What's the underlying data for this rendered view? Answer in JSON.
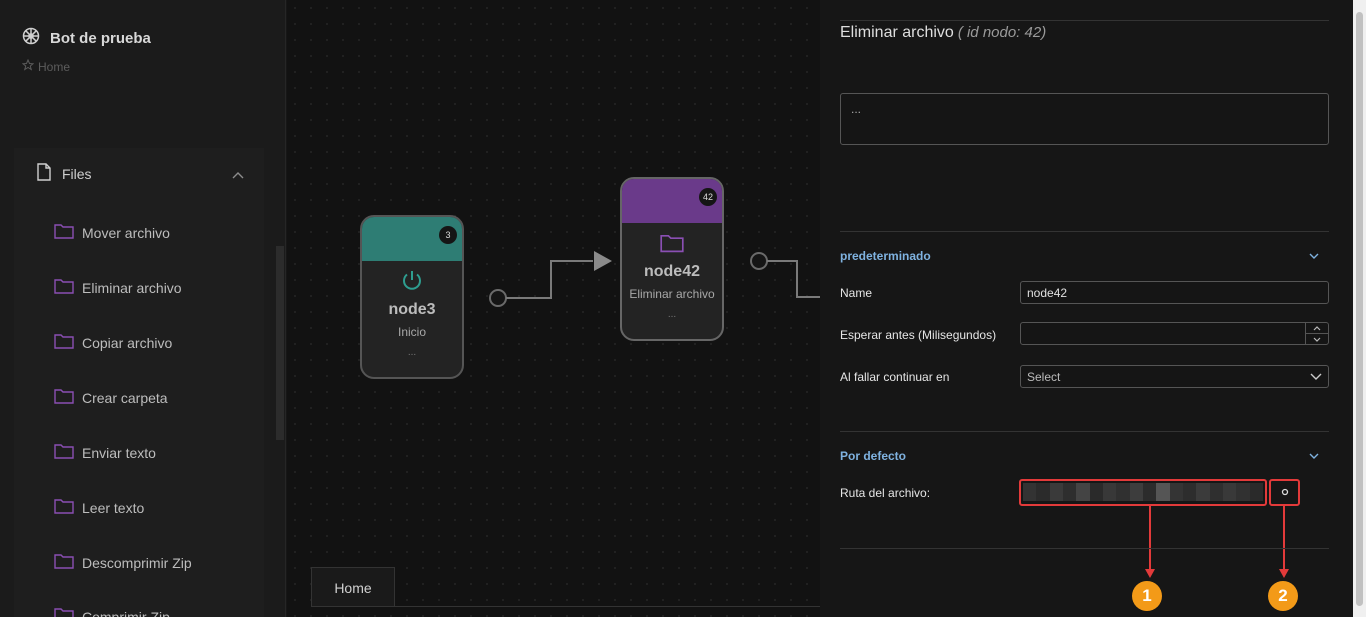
{
  "sidebar": {
    "title": "Bot de prueba",
    "breadcrumb": "Home",
    "section_label": "Files",
    "items": [
      {
        "label": "Mover archivo"
      },
      {
        "label": "Eliminar archivo"
      },
      {
        "label": "Copiar archivo"
      },
      {
        "label": "Crear carpeta"
      },
      {
        "label": "Enviar texto"
      },
      {
        "label": "Leer texto"
      },
      {
        "label": "Descomprimir Zip"
      },
      {
        "label": "Comprimir Zip"
      }
    ]
  },
  "canvas": {
    "nodes": [
      {
        "id": "3",
        "title": "node3",
        "subtitle": "Inicio",
        "dots": "...",
        "color": "#2e7d74",
        "icon": "power-icon"
      },
      {
        "id": "42",
        "title": "node42",
        "subtitle": "Eliminar archivo",
        "dots": "...",
        "color": "#6a3a8a",
        "icon": "folder-icon"
      }
    ],
    "tab_label": "Home"
  },
  "panel": {
    "title": "Eliminar archivo",
    "id_note": "( id nodo: 42)",
    "description_value": "...",
    "section1": {
      "title": "predeterminado",
      "name_label": "Name",
      "name_value": "node42",
      "wait_label": "Esperar antes (Milisegundos)",
      "wait_value": "",
      "fail_label": "Al fallar continuar en",
      "fail_value": "Select"
    },
    "section2": {
      "title": "Por defecto",
      "path_label": "Ruta del archivo:"
    },
    "callouts": [
      "1",
      "2"
    ]
  },
  "colors": {
    "accent_blue": "#7fb2e0",
    "folder_purple": "#8a4fb3",
    "annotation_red": "#e33a3a",
    "callout_orange": "#f39a18",
    "node_teal": "#2e7d74",
    "node_purple": "#6a3a8a"
  }
}
